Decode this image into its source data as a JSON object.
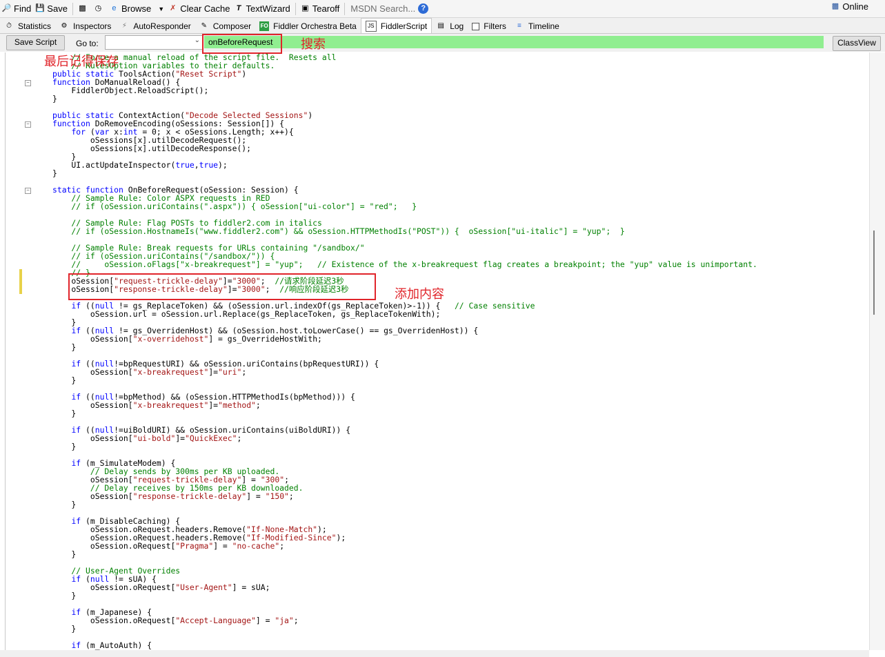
{
  "toolbar": {
    "find": "Find",
    "save": "Save",
    "browse": "Browse",
    "clear_cache": "Clear Cache",
    "textwizard": "TextWizard",
    "tearoff": "Tearoff",
    "msdn_search": "MSDN Search...",
    "online": "Online"
  },
  "tabs": [
    {
      "label": "Statistics",
      "icon": "stopwatch-icon"
    },
    {
      "label": "Inspectors",
      "icon": "inspect-icon"
    },
    {
      "label": "AutoResponder",
      "icon": "lightning-icon"
    },
    {
      "label": "Composer",
      "icon": "compose-icon"
    },
    {
      "label": "Fiddler Orchestra Beta",
      "icon": "fo-icon"
    },
    {
      "label": "FiddlerScript",
      "icon": "script-icon",
      "active": true
    },
    {
      "label": "Log",
      "icon": "log-icon"
    },
    {
      "label": "Filters",
      "icon": "checkbox-icon"
    },
    {
      "label": "Timeline",
      "icon": "timeline-icon"
    }
  ],
  "scriptbar": {
    "save_script": "Save Script",
    "goto_label": "Go to:",
    "goto_value": "",
    "search_value": "onBeforeRequest",
    "classview": "ClassView"
  },
  "annotations": {
    "save_note": "最后记得保存",
    "search_note": "搜索",
    "add_note": "添加内容"
  },
  "code_lines": [
    [
      [
        "cm",
        "    // Force a manual reload of the script file.  Resets all"
      ]
    ],
    [
      [
        "cm",
        "    // RulesOption variables to their defaults."
      ]
    ],
    [
      [
        "kw",
        "public static"
      ],
      [
        "t",
        " ToolsAction("
      ],
      [
        "str",
        "\"Reset Script\""
      ],
      [
        "t",
        ")"
      ]
    ],
    [
      [
        "kw",
        "function"
      ],
      [
        "t",
        " DoManualReload() {"
      ]
    ],
    [
      [
        "t",
        "    FiddlerObject.ReloadScript();"
      ]
    ],
    [
      [
        "t",
        "}"
      ]
    ],
    [
      [
        "t",
        ""
      ]
    ],
    [
      [
        "kw",
        "public static"
      ],
      [
        "t",
        " ContextAction("
      ],
      [
        "str",
        "\"Decode Selected Sessions\""
      ],
      [
        "t",
        ")"
      ]
    ],
    [
      [
        "kw",
        "function"
      ],
      [
        "t",
        " DoRemoveEncoding(oSessions: Session[]) {"
      ]
    ],
    [
      [
        "t",
        "    "
      ],
      [
        "kw",
        "for"
      ],
      [
        "t",
        " ("
      ],
      [
        "kw",
        "var"
      ],
      [
        "t",
        " x:"
      ],
      [
        "kw",
        "int"
      ],
      [
        "t",
        " = 0; x < oSessions.Length; x++){"
      ]
    ],
    [
      [
        "t",
        "        oSessions[x].utilDecodeRequest();"
      ]
    ],
    [
      [
        "t",
        "        oSessions[x].utilDecodeResponse();"
      ]
    ],
    [
      [
        "t",
        "    }"
      ]
    ],
    [
      [
        "t",
        "    UI.actUpdateInspector("
      ],
      [
        "kw",
        "true"
      ],
      [
        "t",
        ","
      ],
      [
        "kw",
        "true"
      ],
      [
        "t",
        ");"
      ]
    ],
    [
      [
        "t",
        "}"
      ]
    ],
    [
      [
        "t",
        ""
      ]
    ],
    [
      [
        "kw",
        "static function"
      ],
      [
        "t",
        " OnBeforeRequest(oSession: Session) {"
      ]
    ],
    [
      [
        "cm",
        "    // Sample Rule: Color ASPX requests in RED"
      ]
    ],
    [
      [
        "cm",
        "    // if (oSession.uriContains(\".aspx\")) { oSession[\"ui-color\"] = \"red\";   }"
      ]
    ],
    [
      [
        "t",
        ""
      ]
    ],
    [
      [
        "cm",
        "    // Sample Rule: Flag POSTs to fiddler2.com in italics"
      ]
    ],
    [
      [
        "cm",
        "    // if (oSession.HostnameIs(\"www.fiddler2.com\") && oSession.HTTPMethodIs(\"POST\")) {  oSession[\"ui-italic\"] = \"yup\";  }"
      ]
    ],
    [
      [
        "t",
        ""
      ]
    ],
    [
      [
        "cm",
        "    // Sample Rule: Break requests for URLs containing \"/sandbox/\""
      ]
    ],
    [
      [
        "cm",
        "    // if (oSession.uriContains(\"/sandbox/\")) {"
      ]
    ],
    [
      [
        "cm",
        "    //     oSession.oFlags[\"x-breakrequest\"] = \"yup\";   // Existence of the x-breakrequest flag creates a breakpoint; the \"yup\" value is unimportant."
      ]
    ],
    [
      [
        "cm",
        "    // }"
      ]
    ],
    [
      [
        "t",
        "    oSession["
      ],
      [
        "str",
        "\"request-trickle-delay\""
      ],
      [
        "t",
        "]="
      ],
      [
        "str",
        "\"3000\""
      ],
      [
        "t",
        ";  "
      ],
      [
        "cm",
        "//请求阶段延迟3秒"
      ]
    ],
    [
      [
        "t",
        "    oSession["
      ],
      [
        "str",
        "\"response-trickle-delay\""
      ],
      [
        "t",
        "]="
      ],
      [
        "str",
        "\"3000\""
      ],
      [
        "t",
        ";  "
      ],
      [
        "cm",
        "//响应阶段延迟3秒"
      ]
    ],
    [
      [
        "t",
        ""
      ]
    ],
    [
      [
        "t",
        "    "
      ],
      [
        "kw",
        "if"
      ],
      [
        "t",
        " (("
      ],
      [
        "kw",
        "null"
      ],
      [
        "t",
        " != gs_ReplaceToken) && (oSession.url.indexOf(gs_ReplaceToken)>-1)) {   "
      ],
      [
        "cm",
        "// Case sensitive"
      ]
    ],
    [
      [
        "t",
        "        oSession.url = oSession.url.Replace(gs_ReplaceToken, gs_ReplaceTokenWith);"
      ]
    ],
    [
      [
        "t",
        "    }"
      ]
    ],
    [
      [
        "t",
        "    "
      ],
      [
        "kw",
        "if"
      ],
      [
        "t",
        " (("
      ],
      [
        "kw",
        "null"
      ],
      [
        "t",
        " != gs_OverridenHost) && (oSession.host.toLowerCase() == gs_OverridenHost)) {"
      ]
    ],
    [
      [
        "t",
        "        oSession["
      ],
      [
        "str",
        "\"x-overridehost\""
      ],
      [
        "t",
        "] = gs_OverrideHostWith;"
      ]
    ],
    [
      [
        "t",
        "    }"
      ]
    ],
    [
      [
        "t",
        ""
      ]
    ],
    [
      [
        "t",
        "    "
      ],
      [
        "kw",
        "if"
      ],
      [
        "t",
        " (("
      ],
      [
        "kw",
        "null"
      ],
      [
        "t",
        "!=bpRequestURI) && oSession.uriContains(bpRequestURI)) {"
      ]
    ],
    [
      [
        "t",
        "        oSession["
      ],
      [
        "str",
        "\"x-breakrequest\""
      ],
      [
        "t",
        "]="
      ],
      [
        "str",
        "\"uri\""
      ],
      [
        "t",
        ";"
      ]
    ],
    [
      [
        "t",
        "    }"
      ]
    ],
    [
      [
        "t",
        ""
      ]
    ],
    [
      [
        "t",
        "    "
      ],
      [
        "kw",
        "if"
      ],
      [
        "t",
        " (("
      ],
      [
        "kw",
        "null"
      ],
      [
        "t",
        "!=bpMethod) && (oSession.HTTPMethodIs(bpMethod))) {"
      ]
    ],
    [
      [
        "t",
        "        oSession["
      ],
      [
        "str",
        "\"x-breakrequest\""
      ],
      [
        "t",
        "]="
      ],
      [
        "str",
        "\"method\""
      ],
      [
        "t",
        ";"
      ]
    ],
    [
      [
        "t",
        "    }"
      ]
    ],
    [
      [
        "t",
        ""
      ]
    ],
    [
      [
        "t",
        "    "
      ],
      [
        "kw",
        "if"
      ],
      [
        "t",
        " (("
      ],
      [
        "kw",
        "null"
      ],
      [
        "t",
        "!=uiBoldURI) && oSession.uriContains(uiBoldURI)) {"
      ]
    ],
    [
      [
        "t",
        "        oSession["
      ],
      [
        "str",
        "\"ui-bold\""
      ],
      [
        "t",
        "]="
      ],
      [
        "str",
        "\"QuickExec\""
      ],
      [
        "t",
        ";"
      ]
    ],
    [
      [
        "t",
        "    }"
      ]
    ],
    [
      [
        "t",
        ""
      ]
    ],
    [
      [
        "t",
        "    "
      ],
      [
        "kw",
        "if"
      ],
      [
        "t",
        " (m_SimulateModem) {"
      ]
    ],
    [
      [
        "cm",
        "        // Delay sends by 300ms per KB uploaded."
      ]
    ],
    [
      [
        "t",
        "        oSession["
      ],
      [
        "str",
        "\"request-trickle-delay\""
      ],
      [
        "t",
        "] = "
      ],
      [
        "str",
        "\"300\""
      ],
      [
        "t",
        ";"
      ]
    ],
    [
      [
        "cm",
        "        // Delay receives by 150ms per KB downloaded."
      ]
    ],
    [
      [
        "t",
        "        oSession["
      ],
      [
        "str",
        "\"response-trickle-delay\""
      ],
      [
        "t",
        "] = "
      ],
      [
        "str",
        "\"150\""
      ],
      [
        "t",
        ";"
      ]
    ],
    [
      [
        "t",
        "    }"
      ]
    ],
    [
      [
        "t",
        ""
      ]
    ],
    [
      [
        "t",
        "    "
      ],
      [
        "kw",
        "if"
      ],
      [
        "t",
        " (m_DisableCaching) {"
      ]
    ],
    [
      [
        "t",
        "        oSession.oRequest.headers.Remove("
      ],
      [
        "str",
        "\"If-None-Match\""
      ],
      [
        "t",
        ");"
      ]
    ],
    [
      [
        "t",
        "        oSession.oRequest.headers.Remove("
      ],
      [
        "str",
        "\"If-Modified-Since\""
      ],
      [
        "t",
        ");"
      ]
    ],
    [
      [
        "t",
        "        oSession.oRequest["
      ],
      [
        "str",
        "\"Pragma\""
      ],
      [
        "t",
        "] = "
      ],
      [
        "str",
        "\"no-cache\""
      ],
      [
        "t",
        ";"
      ]
    ],
    [
      [
        "t",
        "    }"
      ]
    ],
    [
      [
        "t",
        ""
      ]
    ],
    [
      [
        "cm",
        "    // User-Agent Overrides"
      ]
    ],
    [
      [
        "t",
        "    "
      ],
      [
        "kw",
        "if"
      ],
      [
        "t",
        " ("
      ],
      [
        "kw",
        "null"
      ],
      [
        "t",
        " != sUA) {"
      ]
    ],
    [
      [
        "t",
        "        oSession.oRequest["
      ],
      [
        "str",
        "\"User-Agent\""
      ],
      [
        "t",
        "] = sUA;"
      ]
    ],
    [
      [
        "t",
        "    }"
      ]
    ],
    [
      [
        "t",
        ""
      ]
    ],
    [
      [
        "t",
        "    "
      ],
      [
        "kw",
        "if"
      ],
      [
        "t",
        " (m_Japanese) {"
      ]
    ],
    [
      [
        "t",
        "        oSession.oRequest["
      ],
      [
        "str",
        "\"Accept-Language\""
      ],
      [
        "t",
        "] = "
      ],
      [
        "str",
        "\"ja\""
      ],
      [
        "t",
        ";"
      ]
    ],
    [
      [
        "t",
        "    }"
      ]
    ],
    [
      [
        "t",
        ""
      ]
    ],
    [
      [
        "t",
        "    "
      ],
      [
        "kw",
        "if"
      ],
      [
        "t",
        " (m_AutoAuth) {"
      ]
    ]
  ]
}
